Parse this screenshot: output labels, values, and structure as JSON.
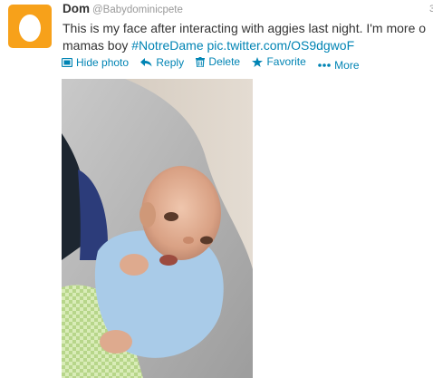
{
  "tweet": {
    "name": "Dom",
    "handle": "@Babydominicpete",
    "timestamp": "3",
    "text_line1": "This is my face after interacting with aggies last night. I'm more o",
    "text_line2_prefix": "mamas boy ",
    "hashtag": "#NotreDame",
    "pic_link": "pic.twitter.com/OS9dgwoF"
  },
  "actions": {
    "hide_photo": "Hide photo",
    "reply": "Reply",
    "delete": "Delete",
    "favorite": "Favorite",
    "more": "More"
  },
  "colors": {
    "link": "#0084b4",
    "avatar_bg": "#f7a11a"
  },
  "icons": [
    "egg-avatar-icon",
    "photo-icon",
    "reply-icon",
    "trash-icon",
    "star-icon",
    "more-dots-icon"
  ]
}
